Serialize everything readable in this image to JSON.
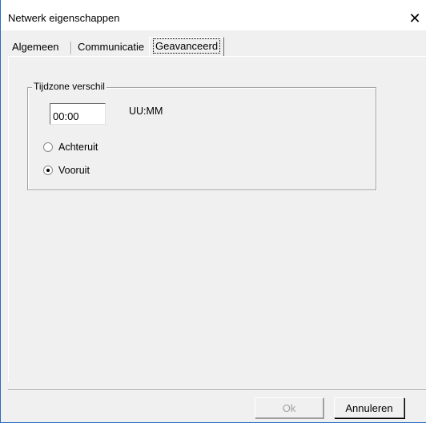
{
  "window": {
    "title": "Netwerk eigenschappen",
    "close_glyph": "✕"
  },
  "tabs": [
    {
      "label": "Algemeen",
      "active": false
    },
    {
      "label": "Communicatie",
      "active": false
    },
    {
      "label": "Geavanceerd",
      "active": true
    }
  ],
  "timezone_group": {
    "legend": "Tijdzone verschil",
    "input_value": "00:00",
    "unit_label": "UU:MM",
    "options": [
      {
        "label": "Achteruit",
        "checked": false
      },
      {
        "label": "Vooruit",
        "checked": true
      }
    ]
  },
  "buttons": {
    "ok_label": "Ok",
    "ok_enabled": false,
    "cancel_label": "Annuleren"
  },
  "colors": {
    "window_border": "#2b6dbf",
    "dialog_background": "#f0f0f0",
    "titlebar_background": "#ffffff"
  }
}
